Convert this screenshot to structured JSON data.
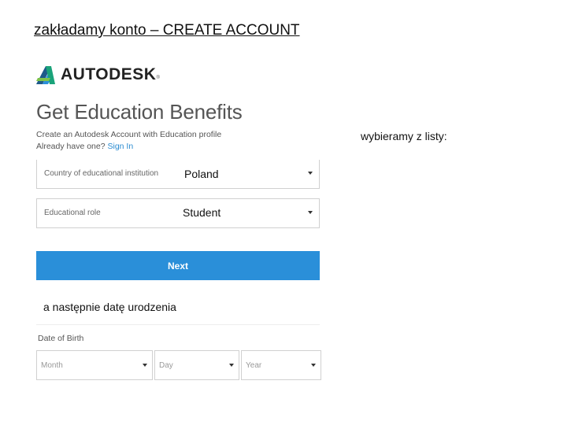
{
  "slide": {
    "title": "zakładamy konto – CREATE ACCOUNT",
    "note_right": "wybieramy z listy:",
    "note_mid": "a następnie datę urodzenia"
  },
  "logo": {
    "text": "AUTODESK",
    "trademark": "®"
  },
  "page": {
    "heading": "Get Education Benefits",
    "subtitle": "Create an Autodesk Account with Education profile",
    "already_text": "Already have one?",
    "sign_in_link": "Sign In"
  },
  "form": {
    "country": {
      "label": "Country of educational institution",
      "value": "Poland"
    },
    "role": {
      "label": "Educational role",
      "value": "Student"
    },
    "next_label": "Next"
  },
  "dob": {
    "label": "Date of Birth",
    "month_placeholder": "Month",
    "day_placeholder": "Day",
    "year_placeholder": "Year"
  },
  "colors": {
    "accent_blue": "#2a8fd9",
    "link_blue": "#2a8bd1"
  },
  "icons": {
    "logo_mark": "autodesk-a-icon",
    "dropdown": "caret-down-icon"
  }
}
